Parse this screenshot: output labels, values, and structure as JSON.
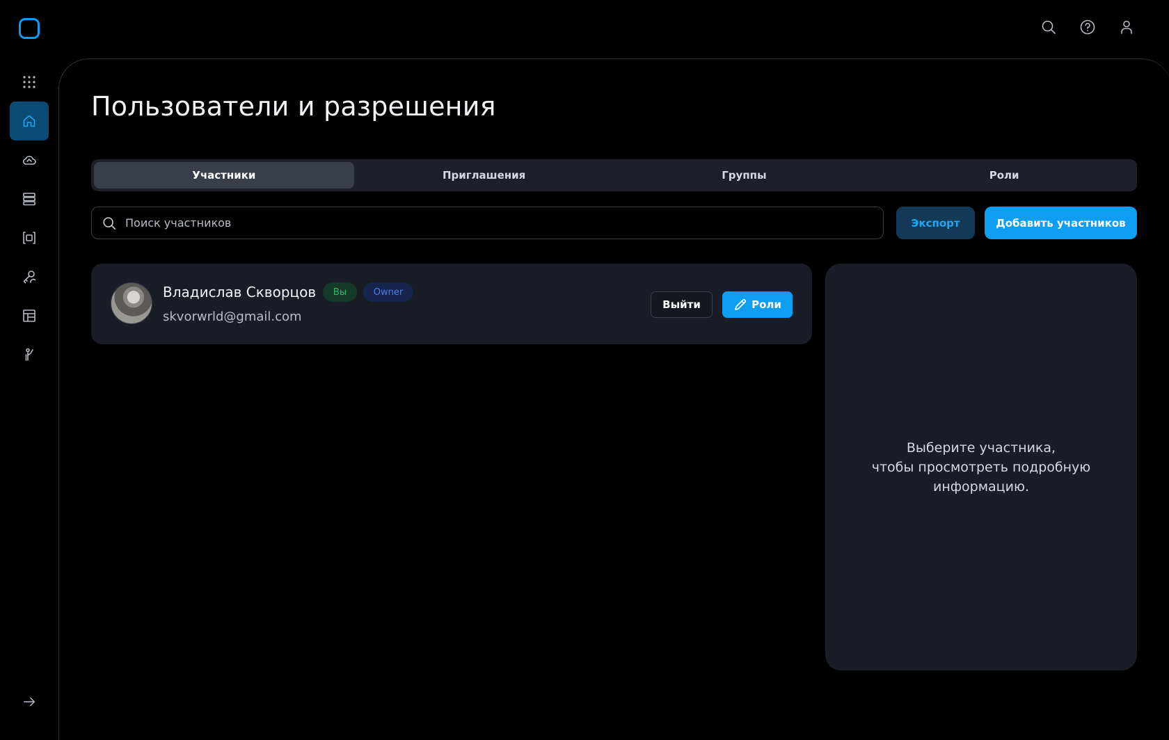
{
  "page": {
    "title": "Пользователи и разрешения"
  },
  "sidebar": {
    "items": [
      {
        "icon": "apps-grid-icon",
        "active": false
      },
      {
        "icon": "home-icon",
        "active": true
      },
      {
        "icon": "cloud-icon",
        "active": false
      },
      {
        "icon": "server-icon",
        "active": false
      },
      {
        "icon": "frame-icon",
        "active": false
      },
      {
        "icon": "key-user-icon",
        "active": false
      },
      {
        "icon": "layout-icon",
        "active": false
      },
      {
        "icon": "support-person-icon",
        "active": false
      }
    ]
  },
  "tabs": [
    {
      "label": "Участники",
      "active": true
    },
    {
      "label": "Приглашения",
      "active": false
    },
    {
      "label": "Группы",
      "active": false
    },
    {
      "label": "Роли",
      "active": false
    }
  ],
  "search": {
    "placeholder": "Поиск участников"
  },
  "actions": {
    "export_label": "Экспорт",
    "add_label": "Добавить участников"
  },
  "member": {
    "name": "Владислав Скворцов",
    "badge_you": "Вы",
    "badge_role": "Owner",
    "email": "skvorwrld@gmail.com",
    "leave_label": "Выйти",
    "roles_label": "Роли"
  },
  "details": {
    "empty_line1": "Выберите участника,",
    "empty_line2": "чтобы просмотреть подробную",
    "empty_line3": "информацию."
  },
  "colors": {
    "accent": "#0d9ef2",
    "background": "#000000",
    "card": "#1a1d26"
  }
}
